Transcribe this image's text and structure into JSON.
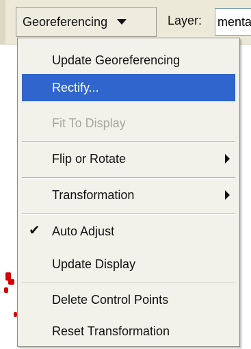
{
  "toolbar": {
    "menu_button_label": "Georeferencing",
    "layer_label": "Layer:",
    "layer_value": "menta"
  },
  "menu": {
    "items": [
      {
        "label": "Update Georeferencing",
        "enabled": true
      },
      {
        "label": "Rectify...",
        "enabled": true,
        "highlighted": true
      },
      {
        "label": "Fit To Display",
        "enabled": false
      },
      {
        "label": "Flip or Rotate",
        "enabled": true,
        "submenu": true
      },
      {
        "label": "Transformation",
        "enabled": true,
        "submenu": true
      },
      {
        "label": "Auto Adjust",
        "enabled": true,
        "checked": true
      },
      {
        "label": "Update Display",
        "enabled": true
      },
      {
        "label": "Delete Control Points",
        "enabled": true
      },
      {
        "label": "Reset Transformation",
        "enabled": true
      }
    ]
  },
  "icons": {
    "dropdown": "chevron-down-icon",
    "submenu": "chevron-right-icon",
    "check": "check-icon"
  },
  "colors": {
    "highlight": "#2f65cc",
    "menu_bg": "#f2f1ea",
    "toolbar_bg": "#ece9d8",
    "disabled_text": "#a8a79f",
    "map_feature": "#d40000"
  }
}
